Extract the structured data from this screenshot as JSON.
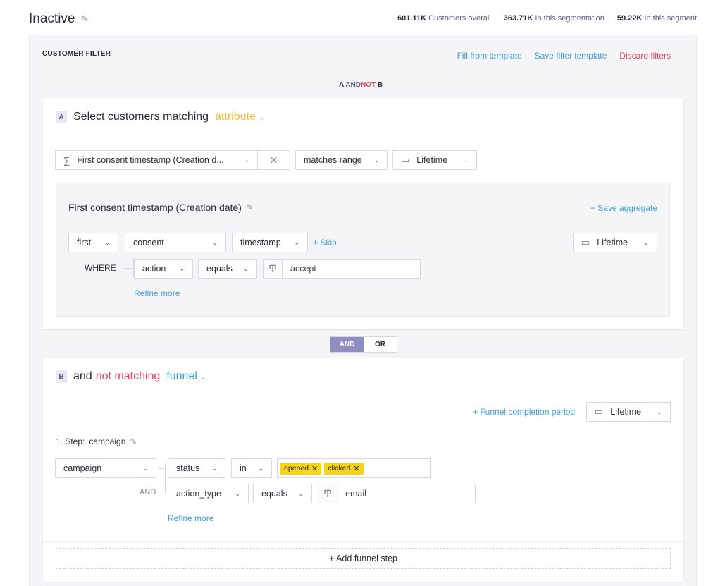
{
  "header": {
    "title": "Inactive",
    "stats": [
      {
        "value": "601.11K",
        "label": "Customers overall"
      },
      {
        "value": "363.71K",
        "label": "In this segmentation"
      },
      {
        "value": "59.22K",
        "label": "In this segment"
      }
    ]
  },
  "filter": {
    "title": "CUSTOMER FILTER",
    "actions": {
      "fill_template": "Fill from template",
      "save_template": "Save filter template",
      "discard": "Discard filters"
    },
    "formula": {
      "a": "A",
      "and": "AND",
      "not": "NOT",
      "b": "B"
    }
  },
  "section_a": {
    "letter": "A",
    "heading": "Select customers matching",
    "type": "attribute",
    "attribute_select": "First consent timestamp (Creation d...",
    "operator": "matches range",
    "period": "Lifetime",
    "aggregate": {
      "title": "First consent timestamp (Creation date)",
      "save": "+ Save aggregate",
      "func": "first",
      "event": "consent",
      "property": "timestamp",
      "skip": "+ Skip",
      "period": "Lifetime",
      "where": "WHERE",
      "cond_property": "action",
      "cond_operator": "equals",
      "cond_value": "accept",
      "refine": "Refine more"
    }
  },
  "connector": {
    "and": "AND",
    "or": "OR"
  },
  "section_b": {
    "letter": "B",
    "and": "and",
    "not_matching": "not matching",
    "type": "funnel",
    "completion_period": "+ Funnel completion period",
    "period": "Lifetime",
    "step_label": "1. Step:",
    "step_name": "campaign",
    "event": "campaign",
    "cond1_property": "status",
    "cond1_operator": "in",
    "cond1_tags": [
      "opened",
      "clicked"
    ],
    "and_label": "AND",
    "cond2_property": "action_type",
    "cond2_operator": "equals",
    "cond2_value": "email",
    "refine": "Refine more",
    "add_step": "+ Add funnel step"
  }
}
